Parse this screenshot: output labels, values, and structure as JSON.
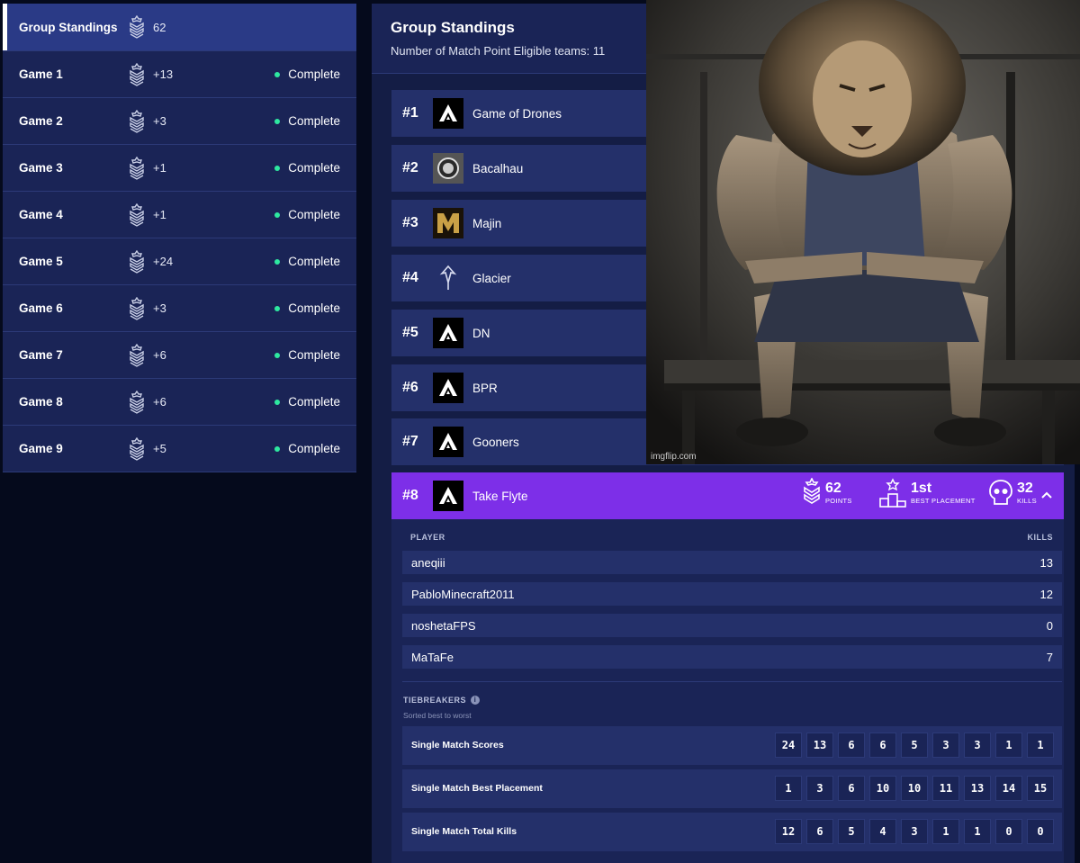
{
  "sidebar": {
    "items": [
      {
        "label": "Group Standings",
        "points": "62",
        "status": "",
        "active": true
      },
      {
        "label": "Game 1",
        "points": "+13",
        "status": "Complete"
      },
      {
        "label": "Game 2",
        "points": "+3",
        "status": "Complete"
      },
      {
        "label": "Game 3",
        "points": "+1",
        "status": "Complete"
      },
      {
        "label": "Game 4",
        "points": "+1",
        "status": "Complete"
      },
      {
        "label": "Game 5",
        "points": "+24",
        "status": "Complete"
      },
      {
        "label": "Game 6",
        "points": "+3",
        "status": "Complete"
      },
      {
        "label": "Game 7",
        "points": "+6",
        "status": "Complete"
      },
      {
        "label": "Game 8",
        "points": "+6",
        "status": "Complete"
      },
      {
        "label": "Game 9",
        "points": "+5",
        "status": "Complete"
      }
    ]
  },
  "main": {
    "title": "Group Standings",
    "subtitle": "Number of Match Point Eligible teams: 11"
  },
  "teams": [
    {
      "rank": "#1",
      "name": "Game of Drones",
      "logo": "apex-logo-icon"
    },
    {
      "rank": "#2",
      "name": "Bacalhau",
      "logo": "bacalhau-logo-icon"
    },
    {
      "rank": "#3",
      "name": "Majin",
      "logo": "majin-logo-icon"
    },
    {
      "rank": "#4",
      "name": "Glacier",
      "logo": "glacier-logo-icon"
    },
    {
      "rank": "#5",
      "name": "DN",
      "logo": "apex-logo-icon"
    },
    {
      "rank": "#6",
      "name": "BPR",
      "logo": "apex-logo-icon"
    },
    {
      "rank": "#7",
      "name": "Gooners",
      "logo": "apex-logo-icon"
    }
  ],
  "expanded_team": {
    "rank": "#8",
    "name": "Take Flyte",
    "points": "62",
    "points_label": "POINTS",
    "best_placement": "1st",
    "best_placement_label": "BEST PLACEMENT",
    "kills": "32",
    "kills_label": "KILLS",
    "player_header": "PLAYER",
    "kills_header": "KILLS",
    "players": [
      {
        "name": "aneqiii",
        "kills": "13"
      },
      {
        "name": "PabloMinecraft2011",
        "kills": "12"
      },
      {
        "name": "noshetaFPS",
        "kills": "0"
      },
      {
        "name": "MaTaFe",
        "kills": "7"
      }
    ],
    "tiebreakers_title": "TIEBREAKERS",
    "tiebreakers_sub": "Sorted best to worst",
    "tiebreakers": [
      {
        "label": "Single Match Scores",
        "values": [
          "24",
          "13",
          "6",
          "6",
          "5",
          "3",
          "3",
          "1",
          "1"
        ]
      },
      {
        "label": "Single Match Best Placement",
        "values": [
          "1",
          "3",
          "6",
          "10",
          "10",
          "11",
          "13",
          "14",
          "15"
        ]
      },
      {
        "label": "Single Match Total Kills",
        "values": [
          "12",
          "6",
          "5",
          "4",
          "3",
          "1",
          "1",
          "0",
          "0"
        ]
      }
    ]
  },
  "meme": {
    "credit": "imgflip.com"
  },
  "colors": {
    "accent": "#7d2fe8",
    "status_complete": "#2ee8a0",
    "panel": "#1a2456",
    "row": "#24306a",
    "background": "#050a1c"
  }
}
